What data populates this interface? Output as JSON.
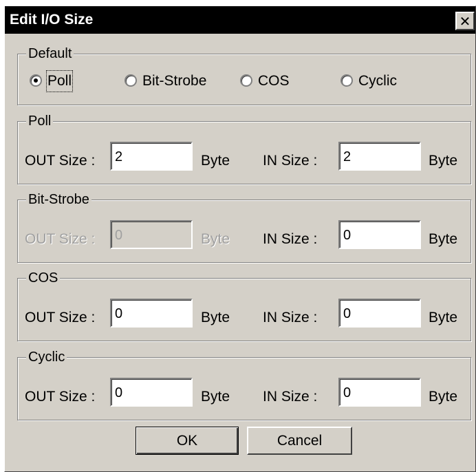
{
  "dialog": {
    "title": "Edit I/O Size",
    "close_glyph": "✕"
  },
  "default_group": {
    "legend": "Default",
    "options": [
      "Poll",
      "Bit-Strobe",
      "COS",
      "Cyclic"
    ],
    "selected": "Poll"
  },
  "groups": [
    {
      "legend": "Poll",
      "out_label": "OUT Size :",
      "out_value": "2",
      "out_unit": "Byte",
      "in_label": "IN Size :",
      "in_value": "2",
      "in_unit": "Byte",
      "out_disabled": false
    },
    {
      "legend": "Bit-Strobe",
      "out_label": "OUT Size :",
      "out_value": "0",
      "out_unit": "Byte",
      "in_label": "IN Size :",
      "in_value": "0",
      "in_unit": "Byte",
      "out_disabled": true
    },
    {
      "legend": "COS",
      "out_label": "OUT Size :",
      "out_value": "0",
      "out_unit": "Byte",
      "in_label": "IN Size :",
      "in_value": "0",
      "in_unit": "Byte",
      "out_disabled": false
    },
    {
      "legend": "Cyclic",
      "out_label": "OUT Size :",
      "out_value": "0",
      "out_unit": "Byte",
      "in_label": "IN Size :",
      "in_value": "0",
      "in_unit": "Byte",
      "out_disabled": false
    }
  ],
  "buttons": {
    "ok": "OK",
    "cancel": "Cancel"
  }
}
